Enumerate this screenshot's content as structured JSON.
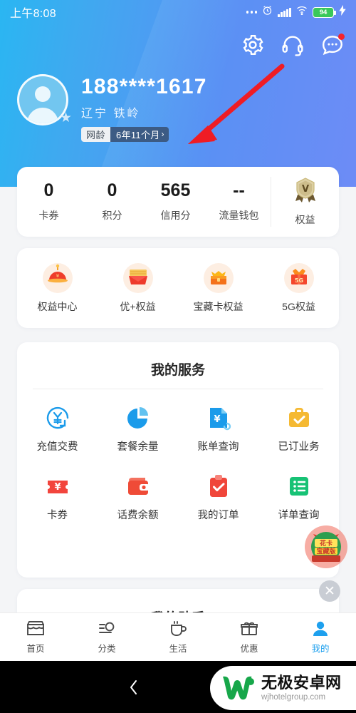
{
  "status_bar": {
    "time": "上午8:08",
    "battery_percent": "94",
    "icons": [
      "more-dots-icon",
      "alarm-icon",
      "signal-bars-icon",
      "wifi-icon",
      "battery-icon",
      "charging-bolt-icon"
    ]
  },
  "header": {
    "actions": [
      {
        "name": "settings-icon",
        "label": "设置"
      },
      {
        "name": "headset-icon",
        "label": "客服"
      },
      {
        "name": "chat-icon",
        "label": "消息",
        "badge": true
      }
    ],
    "profile": {
      "phone_number": "188****1617",
      "region": "辽宁  铁岭",
      "netage_label": "网龄",
      "netage_value": "6年11个月",
      "chevron": "›"
    },
    "gradient_start": "#2ab6f2",
    "gradient_end": "#6d8cf6"
  },
  "stats": {
    "items": [
      {
        "value": "0",
        "label": "卡券"
      },
      {
        "value": "0",
        "label": "积分"
      },
      {
        "value": "565",
        "label": "信用分"
      },
      {
        "value": "--",
        "label": "流量钱包"
      }
    ],
    "rights": {
      "label": "权益",
      "icon": "vip-medal-icon"
    }
  },
  "benefits": {
    "items": [
      {
        "label": "权益中心",
        "icon": "gift-ball-icon"
      },
      {
        "label": "优+权益",
        "icon": "red-envelope-icon"
      },
      {
        "label": "宝藏卡权益",
        "icon": "treasure-chest-icon"
      },
      {
        "label": "5G权益",
        "icon": "5g-gift-icon"
      }
    ]
  },
  "services": {
    "title": "我的服务",
    "items": [
      {
        "label": "充值交费",
        "icon": "recharge-yuan-icon",
        "color": "#1b9bea"
      },
      {
        "label": "套餐余量",
        "icon": "pie-chart-icon",
        "color": "#1b9bea"
      },
      {
        "label": "账单查询",
        "icon": "bill-document-icon",
        "color": "#1b9bea"
      },
      {
        "label": "已订业务",
        "icon": "briefcase-check-icon",
        "color": "#f5b932"
      },
      {
        "label": "卡券",
        "icon": "coupon-ticket-icon",
        "color": "#f2453d"
      },
      {
        "label": "话费余额",
        "icon": "wallet-icon",
        "color": "#ef4b37"
      },
      {
        "label": "我的订单",
        "icon": "clipboard-check-icon",
        "color": "#f0463a"
      },
      {
        "label": "详单查询",
        "icon": "list-lines-icon",
        "color": "#17c275"
      }
    ]
  },
  "assistant": {
    "title": "我的助手"
  },
  "floating_ad": {
    "line1": "花卡",
    "line2": "宝藏版",
    "close_glyph": "✕"
  },
  "bottom_nav": {
    "items": [
      {
        "label": "首页",
        "icon": "store-icon",
        "active": false
      },
      {
        "label": "分类",
        "icon": "category-search-icon",
        "active": false
      },
      {
        "label": "生活",
        "icon": "coffee-cup-icon",
        "active": false
      },
      {
        "label": "优惠",
        "icon": "gift-icon",
        "active": false
      },
      {
        "label": "我的",
        "icon": "person-icon",
        "active": true
      }
    ],
    "active_color": "#1ea0ee"
  },
  "android_nav": {
    "back_glyph": "‹",
    "home_glyph": "□"
  },
  "watermark": {
    "title": "无极安卓网",
    "url": "wjhotelgroup.com"
  },
  "annotation": {
    "type": "red-arrow",
    "color": "#ef1c24",
    "points_to": "网龄 6年11个月"
  }
}
